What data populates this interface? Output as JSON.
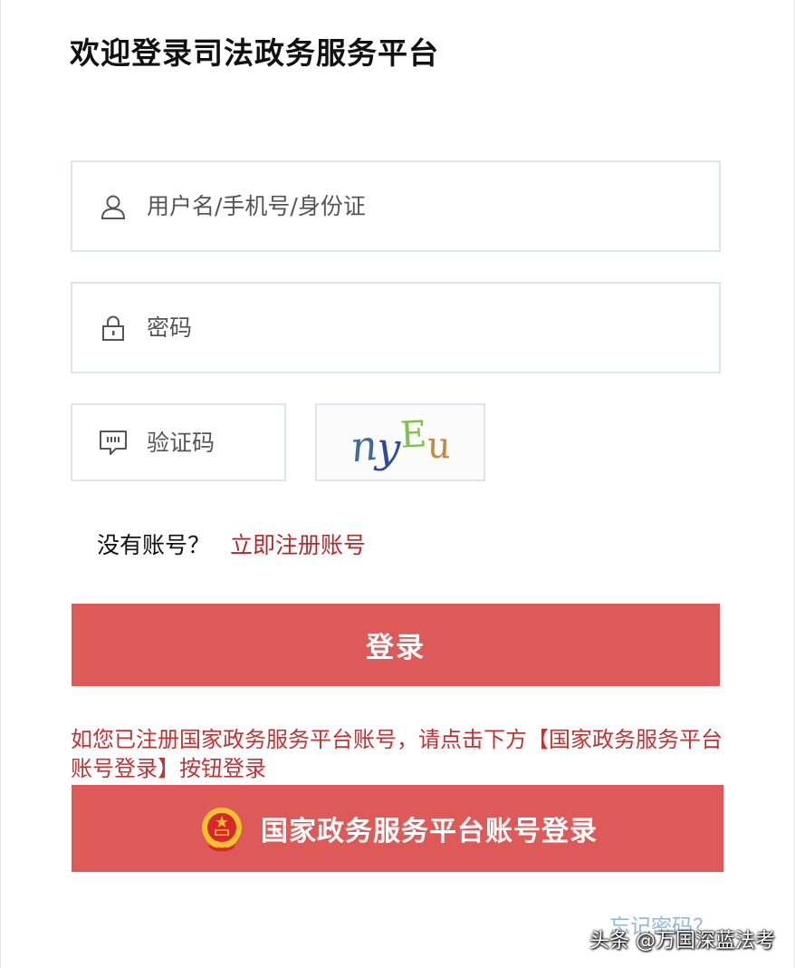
{
  "title": "欢迎登录司法政务服务平台",
  "form": {
    "username_placeholder": "用户名/手机号/身份证",
    "username_icon": "user-icon",
    "password_placeholder": "密码",
    "password_icon": "lock-icon",
    "captcha_placeholder": "验证码",
    "captcha_icon": "message-icon",
    "captcha_chars": [
      {
        "char": "n",
        "color": "#3d6e9a"
      },
      {
        "char": "y",
        "color": "#2b4aa5"
      },
      {
        "char": "E",
        "color": "#7cc24a"
      },
      {
        "char": "u",
        "color": "#c28a3e"
      }
    ]
  },
  "register": {
    "question": "没有账号？",
    "link": "立即注册账号"
  },
  "login_button": "登录",
  "notice": "如您已注册国家政务服务平台账号，请点击下方【国家政务服务平台账号登录】按钮登录",
  "gov_button": {
    "label": "国家政务服务平台账号登录",
    "icon": "national-emblem-icon"
  },
  "forgot_password": "忘记密码？",
  "watermark": "头条 @万国深蓝法考",
  "colors": {
    "primary": "#dd5a58",
    "link": "#b22a2a",
    "notice": "#c23232",
    "border": "#dfe3ea"
  }
}
